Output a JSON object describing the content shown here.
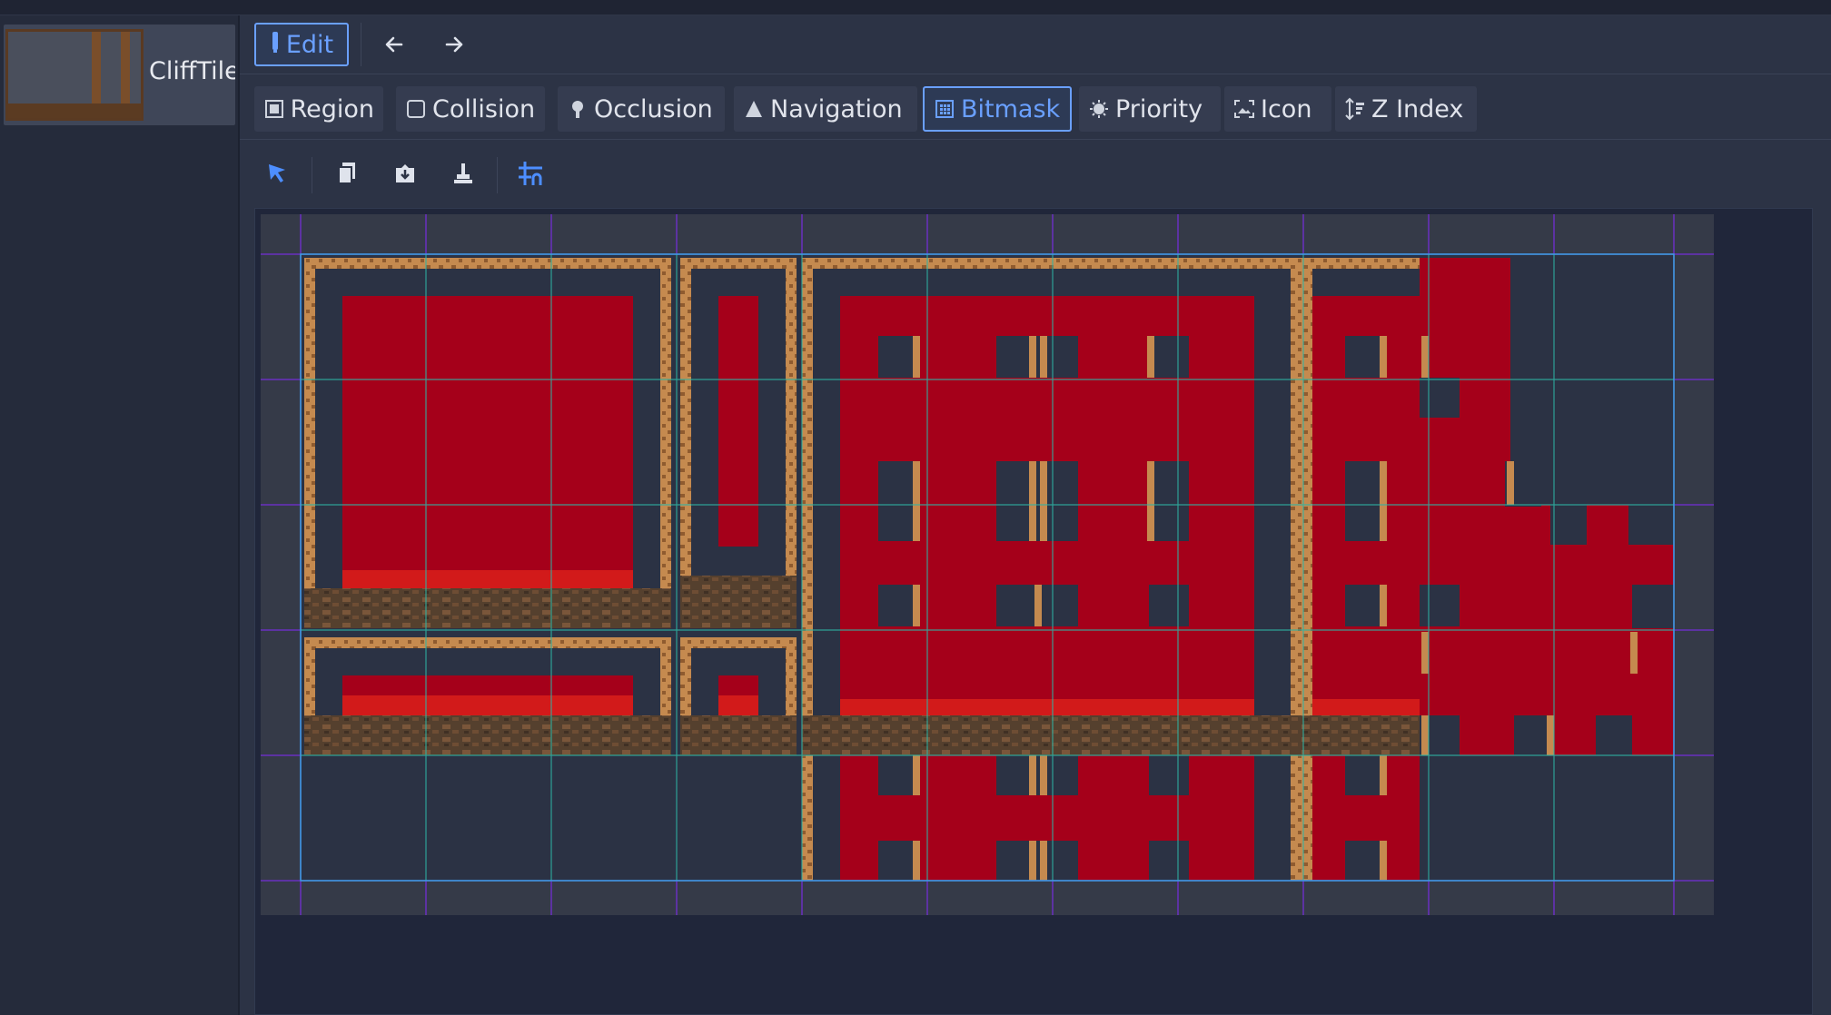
{
  "sidebar": {
    "tile_name": "CliffTile"
  },
  "toolbar": {
    "edit_label": "Edit",
    "icons": [
      "pencil-icon",
      "arrow-left-icon",
      "arrow-right-icon"
    ]
  },
  "tabs": [
    {
      "label": "Region",
      "icon": "region-icon"
    },
    {
      "label": "Collision",
      "icon": "collision-icon"
    },
    {
      "label": "Occlusion",
      "icon": "occlusion-icon"
    },
    {
      "label": "Navigation",
      "icon": "navigation-icon"
    },
    {
      "label": "Bitmask",
      "icon": "bitmask-icon",
      "active": true
    },
    {
      "label": "Priority",
      "icon": "priority-icon"
    },
    {
      "label": "Icon",
      "icon": "icon-icon"
    },
    {
      "label": "Z Index",
      "icon": "z-index-icon"
    }
  ],
  "tools": [
    "select-cursor-icon",
    "copy-icon",
    "paste-icon",
    "erase-icon",
    "snap-grid-icon"
  ],
  "colors": {
    "accent": "#6aa0ff",
    "bitmask": "#a5001a",
    "grid_cyan": "#2fb5a5",
    "grid_purple": "#6a2fc0",
    "dirt": "#c58a4f"
  }
}
